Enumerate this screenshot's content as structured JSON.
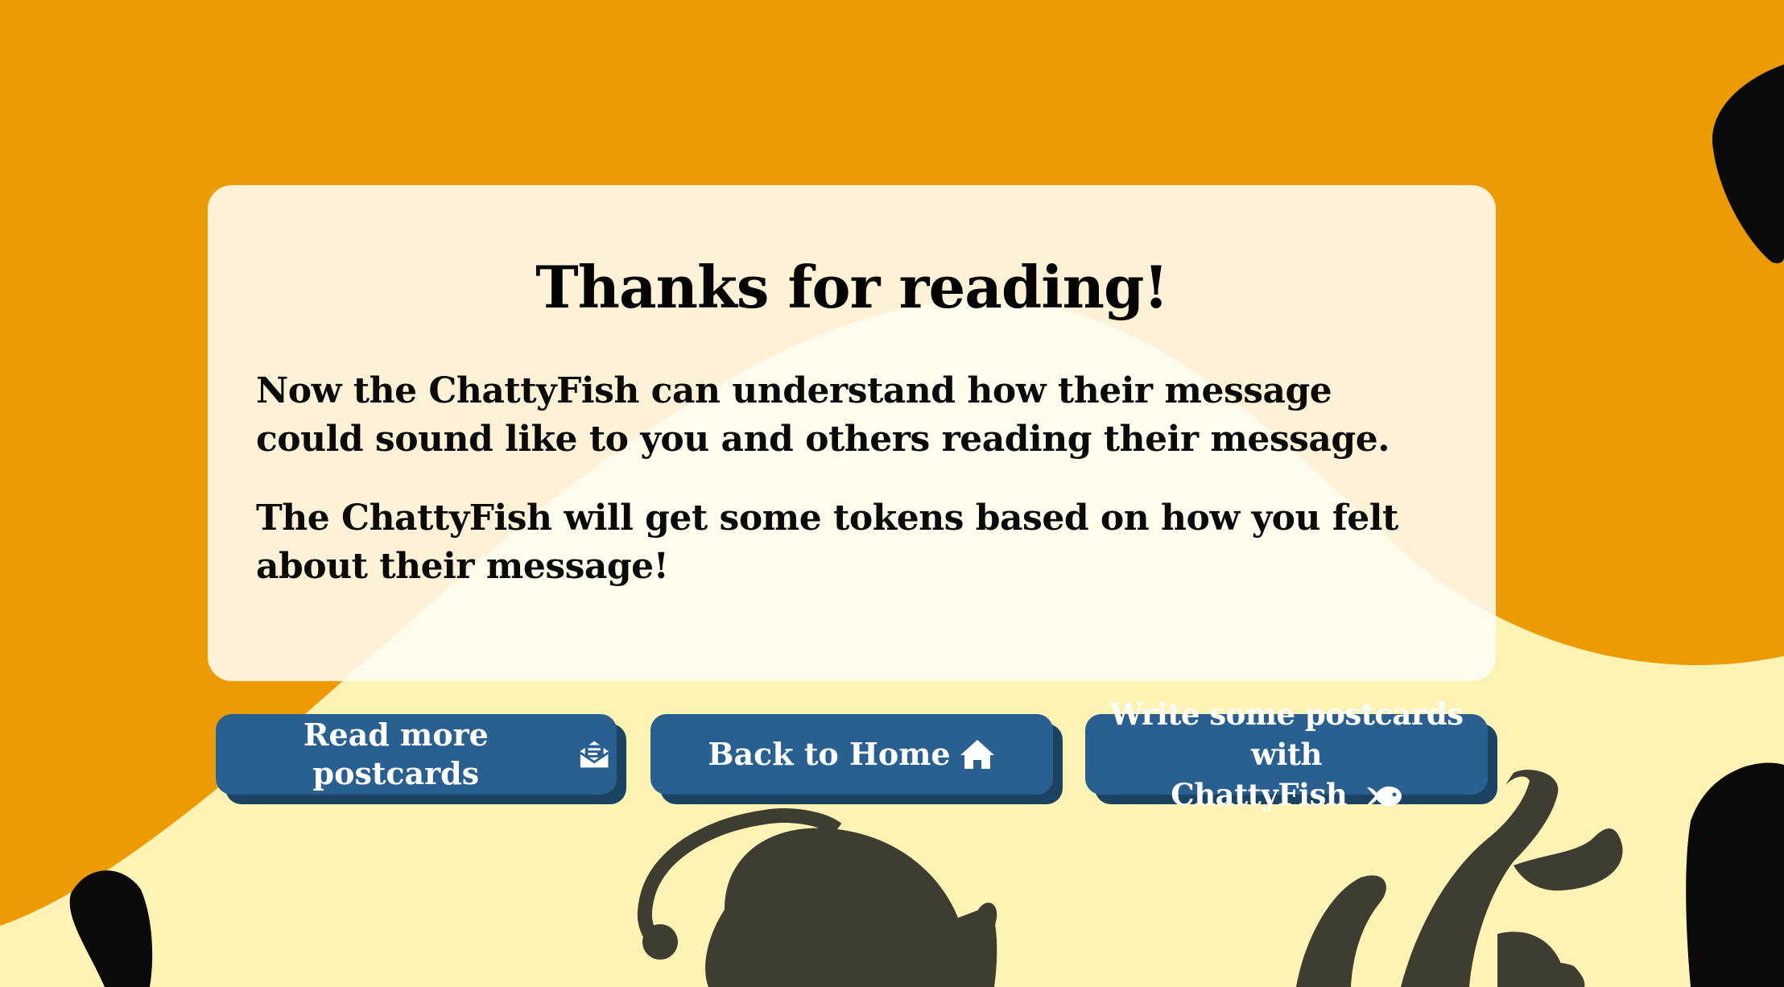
{
  "card": {
    "title": "Thanks for reading!",
    "paragraph_1": "Now the ChattyFish can understand how their message could sound like to you and others reading their message.",
    "paragraph_2": "The ChattyFish will get some tokens based on how you felt about their message!"
  },
  "buttons": {
    "read_more": {
      "label": "Read more postcards",
      "icon": "envelope-open-icon"
    },
    "home": {
      "label": "Back to Home",
      "icon": "home-icon"
    },
    "write": {
      "label_line_1": "Write some postcards with",
      "label_line_2": "ChattyFish",
      "icon": "fish-icon"
    }
  },
  "colors": {
    "orange": "#ed9b05",
    "cream": "#fdf3b4",
    "button": "#2a6090",
    "button_shadow": "#1b4363",
    "silhouette": "#3d3d32",
    "black_blob": "#0a0a0a"
  }
}
